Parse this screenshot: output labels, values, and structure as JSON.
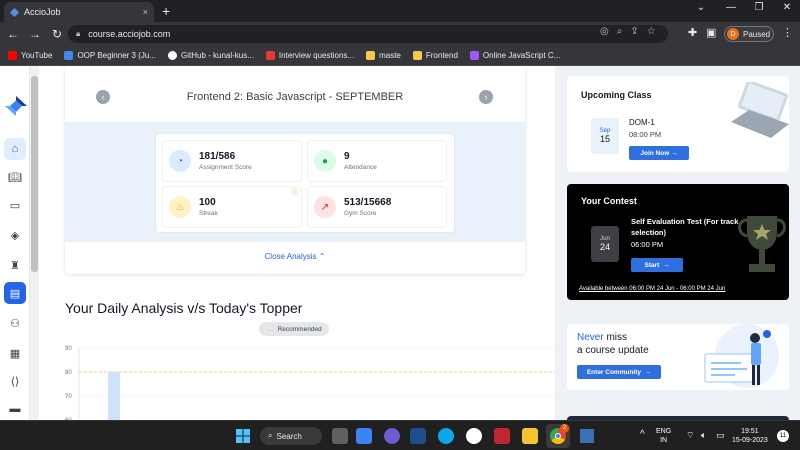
{
  "browser": {
    "tab_title": "AccioJob",
    "tab_close": "×",
    "new_tab": "+",
    "url": "course.acciojob.com",
    "profile_initial": "D",
    "profile_status": "Paused",
    "bookmarks": [
      {
        "label": "YouTube",
        "color": "#ff0000"
      },
      {
        "label": "OOP Beginner 3 (Ju...",
        "color": "#4285f4"
      },
      {
        "label": "GitHub - kunal-kus...",
        "color": "#ffffff"
      },
      {
        "label": "Interview questions...",
        "color": "#e53935"
      },
      {
        "label": "maste",
        "color": "#f9c74f"
      },
      {
        "label": "Frontend",
        "color": "#f9c74f"
      },
      {
        "label": "Online JavaScript C...",
        "color": "#a855f7"
      }
    ]
  },
  "course_card": {
    "title": "Frontend 2: Basic Javascript - SEPTEMBER",
    "stats": [
      {
        "value": "181/586",
        "label": "Assignment Score",
        "icon": "pie-chart-icon",
        "bg": "#dbeafe",
        "fg": "#2563eb"
      },
      {
        "value": "9",
        "label": "Attendance",
        "icon": "person-icon",
        "bg": "#dcfce7",
        "fg": "#16a34a"
      },
      {
        "value": "100",
        "label": "Streak",
        "icon": "flame-icon",
        "bg": "#fef3c7",
        "fg": "#f59e0b"
      },
      {
        "value": "513/15668",
        "label": "Gym Score",
        "icon": "trend-icon",
        "bg": "#fee2e2",
        "fg": "#dc2626"
      }
    ],
    "close_analysis": "Close Analysis",
    "close_chevron": "⌃"
  },
  "daily_analysis": {
    "title": "Your Daily Analysis v/s Today's Topper",
    "recommended_label": "Recommended",
    "recommended_dots": "...."
  },
  "chart_data": {
    "type": "bar",
    "y_ticks": [
      "90",
      "80",
      "70",
      "60"
    ],
    "ylim": [
      60,
      90
    ],
    "reference_line": 80,
    "categories": [
      ""
    ],
    "series": [
      {
        "values": [
          80
        ]
      }
    ]
  },
  "upcoming": {
    "title": "Upcoming Class",
    "month": "Sep",
    "day": "15",
    "class_name": "DOM-1",
    "time": "08:00 PM",
    "button": "Join Now",
    "button_arrow": "→"
  },
  "contest": {
    "title": "Your Contest",
    "name": "Self Evaluation Test (For track selection)",
    "time": "06:00 PM",
    "month": "Jun",
    "day": "24",
    "button": "Start",
    "button_arrow": "→",
    "availability": "Available between 06:00 PM 24 Jun - 06:00 PM 24 Jun"
  },
  "never_miss": {
    "highlight": "Never",
    "line1_rest": " miss",
    "line2": "a course update",
    "button": "Enter Community",
    "button_arrow": "→"
  },
  "taskbar": {
    "search": "Search",
    "lang_top": "ENG",
    "lang_bottom": "IN",
    "time": "19:51",
    "date": "15-09-2023",
    "notif_count": "11",
    "chrome_badge": "2",
    "tray_chevron": "^"
  }
}
